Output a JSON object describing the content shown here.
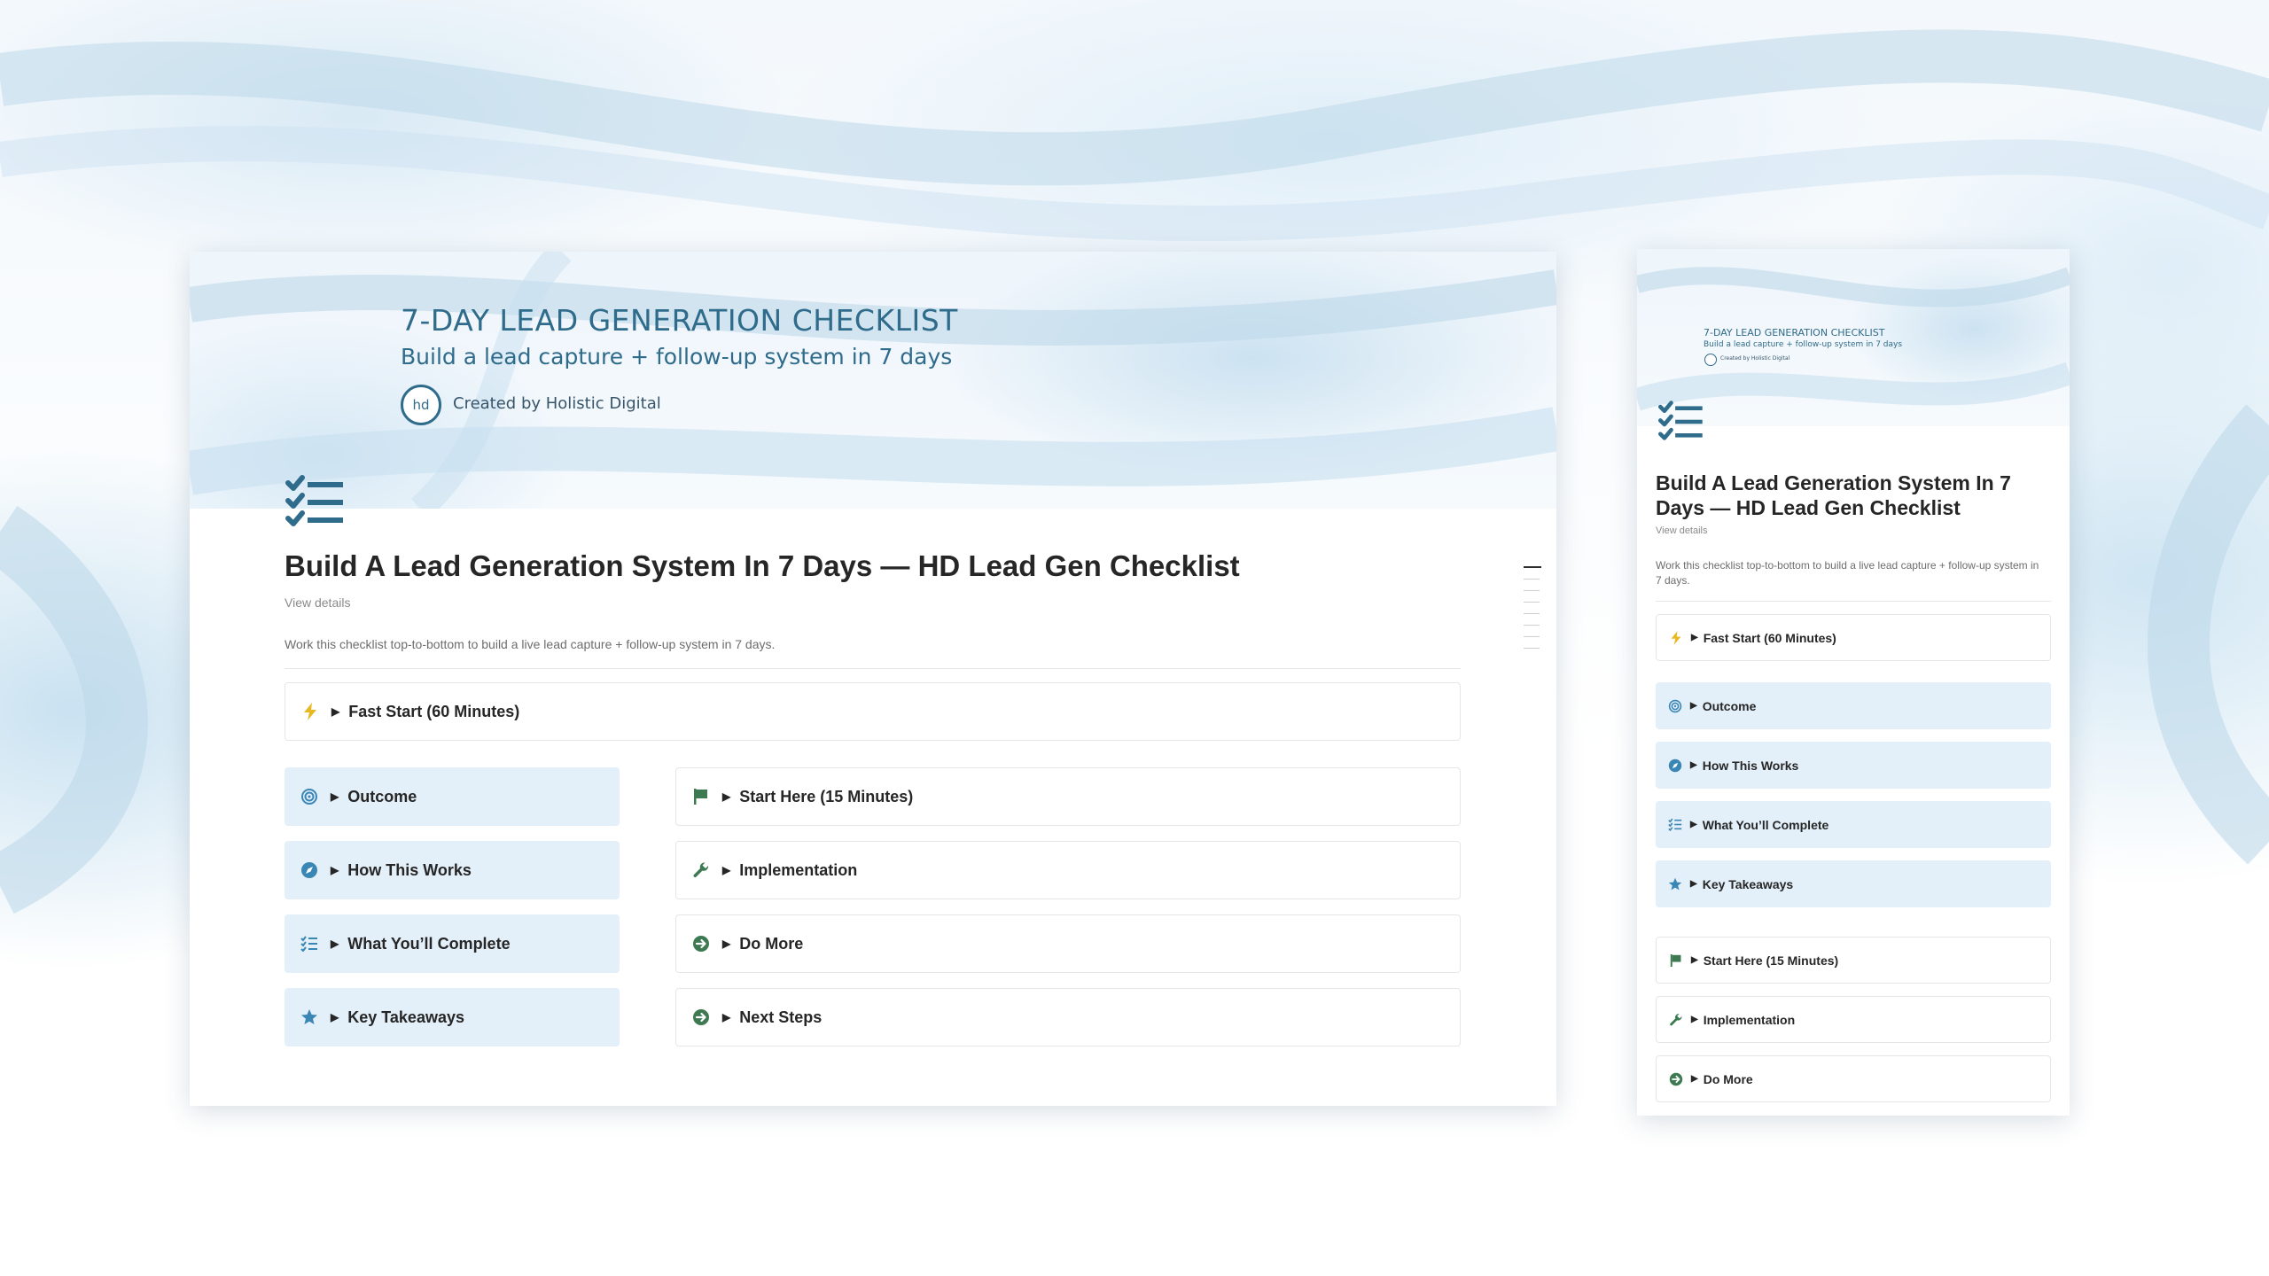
{
  "colors": {
    "accent": "#2f6b8a",
    "callout_blue": "#e3eff9",
    "icon_green": "#3d7a52",
    "icon_blue": "#3a86b5",
    "bolt_yellow": "#e9b820"
  },
  "cover": {
    "title": "7-DAY LEAD GENERATION CHECKLIST",
    "subtitle": "Build a lead capture + follow-up system in 7 days",
    "logo_text": "hd",
    "created_by": "Created by Holistic Digital"
  },
  "page": {
    "title": "Build A Lead Generation System In 7 Days — HD Lead Gen Checklist",
    "view_details": "View details",
    "intro": "Work this checklist top-to-bottom to build a live lead capture + follow-up system in 7 days."
  },
  "toggles": {
    "fast_start": {
      "label": "Fast Start (60 Minutes)",
      "icon": "bolt-icon"
    },
    "outcome": {
      "label": "Outcome",
      "icon": "target-icon"
    },
    "how_this_works": {
      "label": "How This Works",
      "icon": "compass-icon"
    },
    "what_youll_complete": {
      "label": "What You’ll Complete",
      "icon": "checklist-icon"
    },
    "key_takeaways": {
      "label": "Key Takeaways",
      "icon": "star-icon"
    },
    "start_here": {
      "label": "Start Here (15 Minutes)",
      "icon": "flag-icon"
    },
    "implementation": {
      "label": "Implementation",
      "icon": "wrench-icon"
    },
    "do_more": {
      "label": "Do More",
      "icon": "arrow-circle-icon"
    },
    "next_steps": {
      "label": "Next Steps",
      "icon": "arrow-circle-icon"
    }
  }
}
